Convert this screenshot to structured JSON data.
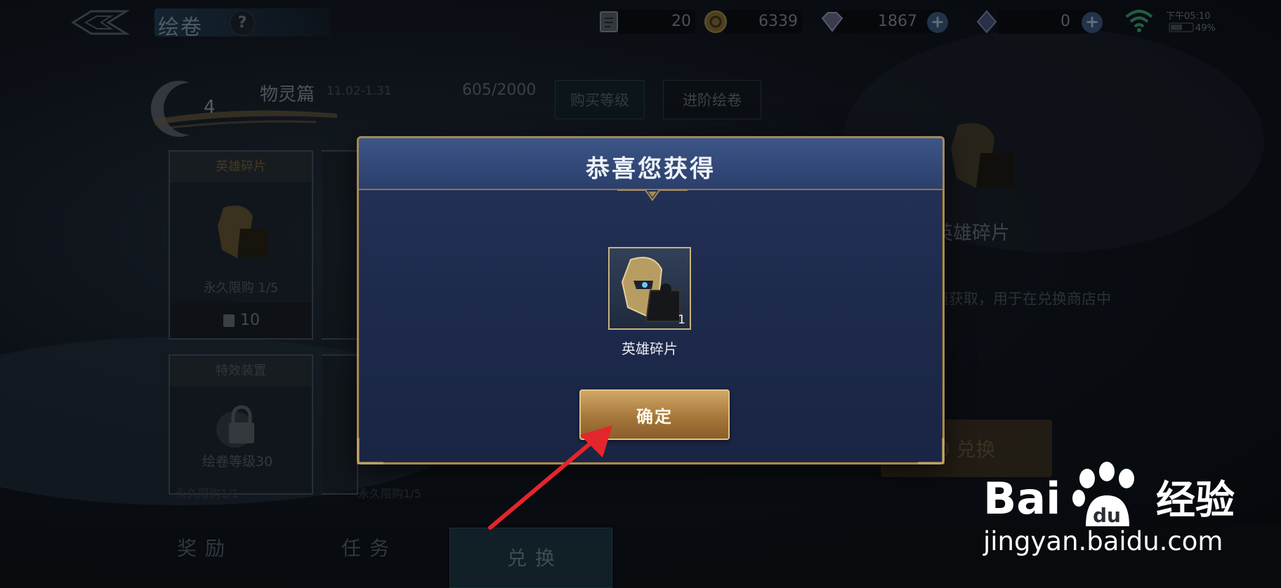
{
  "topbar": {
    "title": "绘卷",
    "help": "?",
    "resources": [
      {
        "icon": "scroll-ticket-icon",
        "value": "20"
      },
      {
        "icon": "gold-coin-icon",
        "value": "6339"
      },
      {
        "icon": "diamond-icon",
        "value": "1867"
      },
      {
        "icon": "crystal-icon",
        "value": "0"
      }
    ],
    "time": "下午05:10",
    "battery": "49%"
  },
  "season": {
    "level": "4",
    "name": "物灵篇",
    "dates": "11.02-1.31",
    "progress": "605/2000",
    "buy_level": "购买等级",
    "advanced": "进阶绘卷"
  },
  "cards": [
    {
      "header": "英雄碎片",
      "sub": "永久限购 1/5",
      "price": "10"
    },
    {
      "header": "特效装置",
      "sub": "绘卷等级30"
    }
  ],
  "bg_labels": [
    "永久限购1/1",
    "永久限购1/5"
  ],
  "right_panel": {
    "name": "英雄碎片",
    "desc": "道获取，用于在兑换商店中",
    "exchange": "0 兑换"
  },
  "tabs": [
    "奖励",
    "任务",
    "兑换"
  ],
  "dialog": {
    "title": "恭喜您获得",
    "item_name": "英雄碎片",
    "item_count": "1",
    "confirm": "确定"
  },
  "watermark": {
    "brand_a": "Bai",
    "brand_b": "du",
    "brand_c": "经验",
    "url": "jingyan.baidu.com"
  },
  "colors": {
    "dialog_border": "#a38a5a",
    "confirm_gold": "#c8964f",
    "arrow_red": "#e3262b"
  }
}
